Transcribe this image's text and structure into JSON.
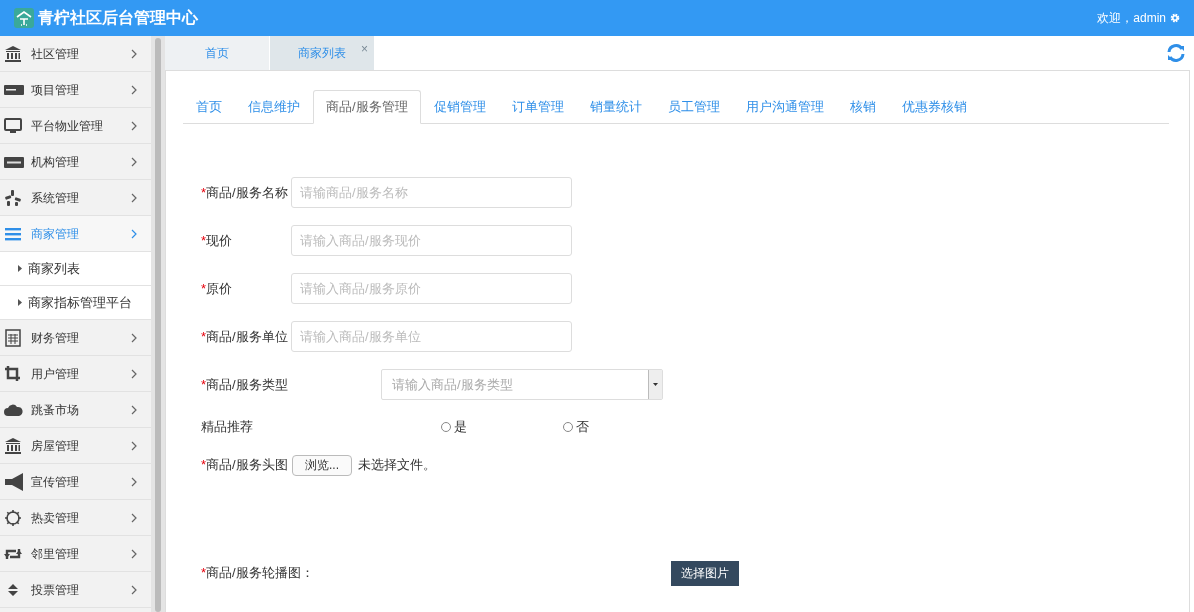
{
  "header": {
    "title": "青柠社区后台管理中心",
    "welcome": "欢迎，admin"
  },
  "sidebar": {
    "items": [
      {
        "label": "社区管理",
        "selected": false
      },
      {
        "label": "项目管理",
        "selected": false
      },
      {
        "label": "平台物业管理",
        "selected": false
      },
      {
        "label": "机构管理",
        "selected": false
      },
      {
        "label": "系统管理",
        "selected": false
      },
      {
        "label": "商家管理",
        "selected": true,
        "children": [
          {
            "label": "商家列表"
          },
          {
            "label": "商家指标管理平台"
          }
        ]
      },
      {
        "label": "财务管理",
        "selected": false
      },
      {
        "label": "用户管理",
        "selected": false
      },
      {
        "label": "跳蚤市场",
        "selected": false
      },
      {
        "label": "房屋管理",
        "selected": false
      },
      {
        "label": "宣传管理",
        "selected": false
      },
      {
        "label": "热卖管理",
        "selected": false
      },
      {
        "label": "邻里管理",
        "selected": false
      },
      {
        "label": "投票管理",
        "selected": false
      }
    ]
  },
  "page_tabs": [
    {
      "label": "首页",
      "selected": false
    },
    {
      "label": "商家列表",
      "selected": true,
      "close": "×"
    }
  ],
  "section_tabs": [
    {
      "label": "首页",
      "selected": false
    },
    {
      "label": "信息维护",
      "selected": false
    },
    {
      "label": "商品/服务管理",
      "selected": true
    },
    {
      "label": "促销管理",
      "selected": false
    },
    {
      "label": "订单管理",
      "selected": false
    },
    {
      "label": "销量统计",
      "selected": false
    },
    {
      "label": "员工管理",
      "selected": false
    },
    {
      "label": "用户沟通管理",
      "selected": false
    },
    {
      "label": "核销",
      "selected": false
    },
    {
      "label": "优惠券核销",
      "selected": false
    }
  ],
  "form": {
    "fields": [
      {
        "kind": "text",
        "required_mark": "*",
        "label": "商品/服务名称",
        "placeholder": "请输商品/服务名称"
      },
      {
        "kind": "text",
        "required_mark": "*",
        "label": "现价",
        "placeholder": "请输入商品/服务现价"
      },
      {
        "kind": "text",
        "required_mark": "*",
        "label": "原价",
        "placeholder": "请输入商品/服务原价"
      },
      {
        "kind": "text",
        "required_mark": "*",
        "label": "商品/服务单位",
        "placeholder": "请输入商品/服务单位"
      },
      {
        "kind": "select",
        "required_mark": "*",
        "label": "商品/服务类型",
        "placeholder": "请输入商品/服务类型"
      },
      {
        "kind": "radio",
        "label": "精品推荐",
        "options": [
          {
            "label": "是",
            "selected": false
          },
          {
            "label": "否",
            "selected": false
          }
        ]
      },
      {
        "kind": "file",
        "required_mark": "*",
        "label": "商品/服务头图",
        "button": "浏览...",
        "status": "未选择文件。"
      },
      {
        "kind": "image",
        "required_mark": "*",
        "label": "商品/服务轮播图：",
        "button": "选择图片"
      }
    ]
  }
}
